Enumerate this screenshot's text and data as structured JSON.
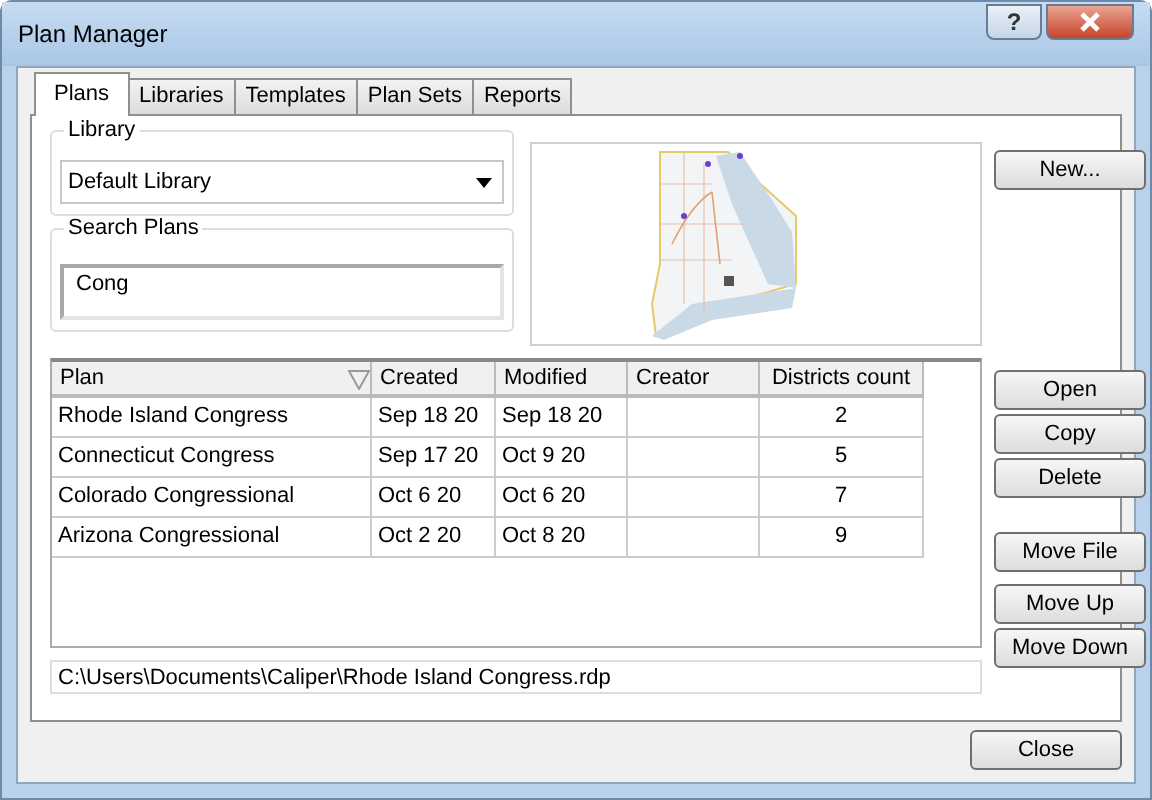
{
  "window": {
    "title": "Plan Manager",
    "help_button": "?"
  },
  "tabs": [
    {
      "label": "Plans",
      "selected": true
    },
    {
      "label": "Libraries",
      "selected": false
    },
    {
      "label": "Templates",
      "selected": false
    },
    {
      "label": "Plan Sets",
      "selected": false
    },
    {
      "label": "Reports",
      "selected": false
    }
  ],
  "library": {
    "label": "Library",
    "value": "Default Library"
  },
  "search": {
    "label": "Search Plans",
    "value": "Cong"
  },
  "table": {
    "columns": [
      "Plan",
      "Created",
      "Modified",
      "Creator",
      "Districts count"
    ],
    "rows": [
      {
        "cells": [
          "Rhode Island Congress",
          "Sep 18 20",
          "Sep 18 20",
          "",
          "2"
        ],
        "selected": false
      },
      {
        "cells": [
          "Connecticut Congress",
          "Sep 17 20",
          "Oct 9 20",
          "",
          "5"
        ],
        "selected": false
      },
      {
        "cells": [
          "Colorado Congressional",
          "Oct 6 20",
          "Oct 6 20",
          "",
          "7"
        ],
        "selected": false
      },
      {
        "cells": [
          "Arizona Congressional",
          "Oct 2 20",
          "Oct 8 20",
          "",
          "9"
        ],
        "selected": false
      }
    ]
  },
  "path": "C:\\Users\\Documents\\Caliper\\Rhode Island Congress.rdp",
  "side_buttons": [
    {
      "label": "New...",
      "kind": "top"
    },
    {
      "label": "Open",
      "kind": "list"
    },
    {
      "label": "Copy",
      "kind": "list"
    },
    {
      "label": "Delete",
      "kind": "list"
    },
    {
      "label": "Move File",
      "kind": "gap"
    },
    {
      "label": "Move Up",
      "kind": "gap"
    },
    {
      "label": "Move Down",
      "kind": "list"
    }
  ],
  "footer_buttons": [
    "Close"
  ]
}
